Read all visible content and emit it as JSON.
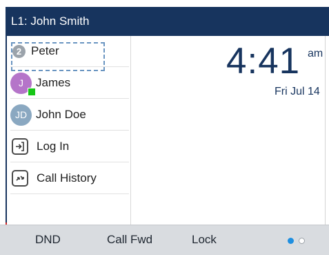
{
  "header": {
    "title": "L1: John Smith"
  },
  "contacts": [
    {
      "name": "Peter",
      "badge": "2"
    },
    {
      "name": "James",
      "initials": "J",
      "avatar_color": "#b575c9",
      "presence_color": "#17c617"
    },
    {
      "name": "John Doe",
      "initials": "JD",
      "avatar_color": "#8aa8c1"
    }
  ],
  "actions": [
    {
      "label": "Log In",
      "icon": "login-icon"
    },
    {
      "label": "Call History",
      "icon": "call-history-icon"
    }
  ],
  "clock": {
    "time": "4:41",
    "ampm": "am",
    "date": "Fri Jul 14"
  },
  "softkeys": {
    "dnd": "DND",
    "call_fwd": "Call Fwd",
    "lock": "Lock"
  },
  "pagination": {
    "pages": 2,
    "current": 1,
    "active_color": "#1f8fe0"
  },
  "colors": {
    "header_bg": "#17345e",
    "accent": "#17345e",
    "softkey_bg": "#d9dce0"
  }
}
